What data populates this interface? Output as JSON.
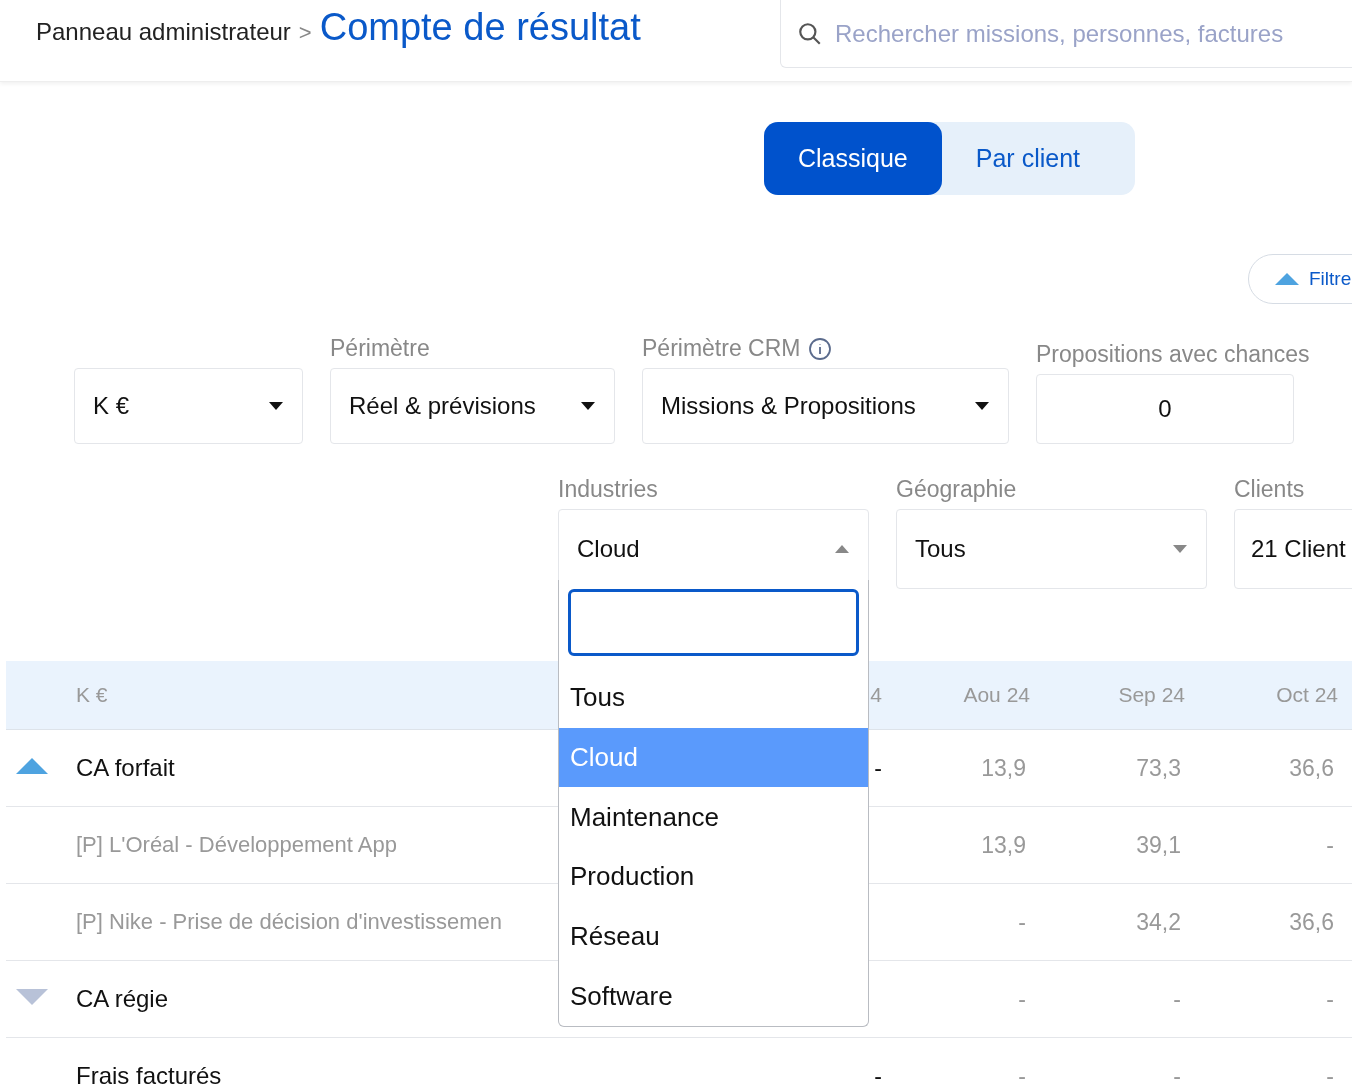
{
  "header": {
    "breadcrumb_parent": "Panneau administrateur",
    "separator": ">",
    "title": "Compte de résultat",
    "search": {
      "placeholder": "Rechercher missions, personnes, factures"
    }
  },
  "view_toggle": [
    {
      "label": "Classique",
      "selected": true
    },
    {
      "label": "Par client",
      "selected": false
    }
  ],
  "filters_button": {
    "label": "Filtre",
    "expanded": true
  },
  "filters_row_1": [
    {
      "value": "K €",
      "kind": "select"
    },
    {
      "label": "Périmètre",
      "value": "Réel & prévisions",
      "kind": "select"
    },
    {
      "label": "Périmètre CRM",
      "value": "Missions & Propositions",
      "kind": "select",
      "info": true
    },
    {
      "label": "Propositions avec chances",
      "value": "0",
      "kind": "number"
    }
  ],
  "filters_row_2": [
    {
      "label": "Industries",
      "value": "Cloud",
      "expanded": true
    },
    {
      "label": "Géographie",
      "value": "Tous",
      "expanded": false
    },
    {
      "label": "Clients",
      "value": "21 Client"
    }
  ],
  "industries_dropdown": {
    "options": [
      {
        "label": "Tous",
        "selected": false
      },
      {
        "label": "Cloud",
        "selected": true
      },
      {
        "label": "Maintenance",
        "selected": false
      },
      {
        "label": "Production",
        "selected": false
      },
      {
        "label": "Réseau",
        "selected": false
      },
      {
        "label": "Software",
        "selected": false
      }
    ]
  },
  "table": {
    "label_column": "K €",
    "columns": [
      "4",
      "Aou 24",
      "Sep 24",
      "Oct 24"
    ],
    "rows": [
      {
        "label": "CA forfait",
        "kind": "group",
        "expanded": true,
        "cells": [
          "-",
          "13,9",
          "73,3",
          "36,6"
        ]
      },
      {
        "label": "[P] L'Oréal - Développement App",
        "kind": "child",
        "cells": [
          null,
          "13,9",
          "39,1",
          "-"
        ]
      },
      {
        "label": "[P] Nike - Prise de décision d'investissemen",
        "kind": "child",
        "cells": [
          null,
          "-",
          "34,2",
          "36,6"
        ]
      },
      {
        "label": "CA régie",
        "kind": "group",
        "expanded": false,
        "cells": [
          null,
          "-",
          "-",
          "-"
        ]
      },
      {
        "label": "Frais facturés",
        "kind": "plain",
        "cells": [
          "-",
          "-",
          "-",
          "-"
        ]
      }
    ]
  }
}
